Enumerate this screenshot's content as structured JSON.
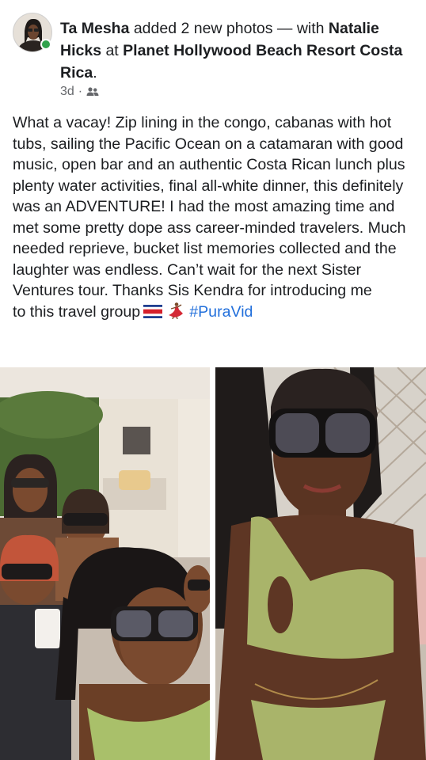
{
  "post": {
    "author": "Ta Mesha",
    "action": " added 2 new photos — with ",
    "tagged": "Natalie Hicks",
    "at": " at ",
    "place": "Planet Hollywood Beach Resort Costa Rica",
    "period": ".",
    "time": "3d",
    "separator": "·",
    "audience_icon": "friends-icon",
    "body": "What a vacay! Zip lining in the congo, cabanas with hot tubs, sailing the Pacific Ocean on a catamaran with good music, open bar and an authentic Costa Rican lunch plus plenty water activities, final all-white dinner, this definitely was an ADVENTURE! I had the most amazing time and met some pretty dope ass career-minded travelers. Much needed reprieve, bucket list memories collected and the laughter was endless. Can’t wait for the next Sister Ventures tour. Thanks Sis Kendra for introducing me",
    "body_tail": "to this travel group",
    "emoji_1": "costa-rica-flag-icon",
    "emoji_2": "dancer-icon",
    "hashtag": "#PuraVid"
  },
  "colors": {
    "text": "#1c1e21",
    "secondary": "#65676b",
    "link": "#216fdb",
    "online": "#31a24c",
    "divider": "#ffffff"
  },
  "photos": [
    {
      "name": "group-selfie-photo"
    },
    {
      "name": "pool-selfie-photo"
    }
  ]
}
